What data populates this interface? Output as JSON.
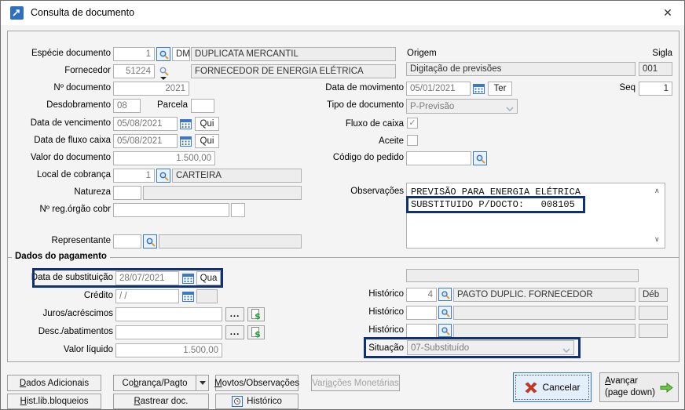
{
  "window": {
    "title": "Consulta de documento",
    "close_icon": "✕"
  },
  "left": {
    "especie": {
      "label": "Espécie documento",
      "code": "1",
      "sigla": "DM",
      "desc": "DUPLICATA MERCANTIL"
    },
    "fornecedor": {
      "label": "Fornecedor",
      "code": "51224",
      "desc": "FORNECEDOR DE ENERGIA ELÉTRICA"
    },
    "num_doc": {
      "label": "Nº documento",
      "value": "2021"
    },
    "desdobramento": {
      "label": "Desdobramento",
      "value": "08"
    },
    "parcela": {
      "label": "Parcela",
      "value": ""
    },
    "vencimento": {
      "label": "Data de vencimento",
      "value": "05/08/2021",
      "dow": "Qui"
    },
    "fluxo_caixa_data": {
      "label": "Data de fluxo caixa",
      "value": "05/08/2021",
      "dow": "Qui"
    },
    "valor_documento": {
      "label": "Valor do documento",
      "value": "1.500,00"
    },
    "local_cobranca": {
      "label": "Local de cobrança",
      "code": "1",
      "desc": "CARTEIRA"
    },
    "natureza": {
      "label": "Natureza",
      "code": "",
      "desc": ""
    },
    "reg_orgao": {
      "label": "Nº reg.órgão cobr",
      "value": "",
      "extra": ""
    },
    "representante": {
      "label": "Representante",
      "code": "",
      "desc": ""
    }
  },
  "right": {
    "origem": {
      "label": "Origem",
      "value": "Digitação de previsões"
    },
    "sigla": {
      "label": "Sigla",
      "value": "001"
    },
    "movimento": {
      "label": "Data de movimento",
      "value": "05/01/2021",
      "dow": "Ter"
    },
    "seq": {
      "label": "Seq",
      "value": "1"
    },
    "tipo_documento": {
      "label": "Tipo de documento",
      "value": "P-Previsão"
    },
    "fluxo_caixa": {
      "label": "Fluxo de caixa",
      "checked": "✓"
    },
    "aceite": {
      "label": "Aceite",
      "checked": ""
    },
    "codigo_pedido": {
      "label": "Código do pedido",
      "value": ""
    },
    "observacoes": {
      "label": "Observações",
      "line1": "PREVISÃO PARA ENERGIA ELÉTRICA",
      "line2": "SUBSTITUIDO P/DOCTO:   008105"
    }
  },
  "pagamento": {
    "group_label": "Dados do pagamento",
    "substituicao": {
      "label": "Data de substituição",
      "value": "28/07/2021",
      "dow": "Qua"
    },
    "credito": {
      "label": "Crédito",
      "value": "/ /",
      "extra": ""
    },
    "juros": {
      "label": "Juros/acréscimos",
      "value": "",
      "more": "..."
    },
    "descontos": {
      "label": "Desc./abatimentos",
      "value": "",
      "more": "..."
    },
    "valor_liquido": {
      "label": "Valor líquido",
      "value": "1.500,00"
    },
    "extra_field": {
      "value": ""
    },
    "hist1": {
      "label": "Histórico",
      "code": "4",
      "desc": "PAGTO DUPLIC. FORNECEDOR",
      "tipo": "Déb"
    },
    "hist2": {
      "label": "Histórico",
      "code": "",
      "desc": "",
      "tipo": ""
    },
    "hist3": {
      "label": "Histórico",
      "code": "",
      "desc": "",
      "tipo": ""
    },
    "situacao": {
      "label": "Situação",
      "value": "07-Substituído"
    }
  },
  "buttons": {
    "dados_adicionais": "&Dados Adicionais",
    "cobranca_pagto": "Co&brança/Pagto",
    "movtos_observacoes": "&Movtos/Observações",
    "variacoes_monetarias": "Var&i&ações Monetárias",
    "hist_lib_bloqueios": "&Hist.lib.bloqueios",
    "rastrear_doc": "&Rastrear doc.",
    "historico": "Histórico",
    "cancelar": "Cancelar",
    "avancar_line1": "&Avançar",
    "avancar_line2": "(page down)"
  },
  "colors": {
    "highlight": "#0f3175",
    "accent_blue": "#2f6fc1"
  }
}
